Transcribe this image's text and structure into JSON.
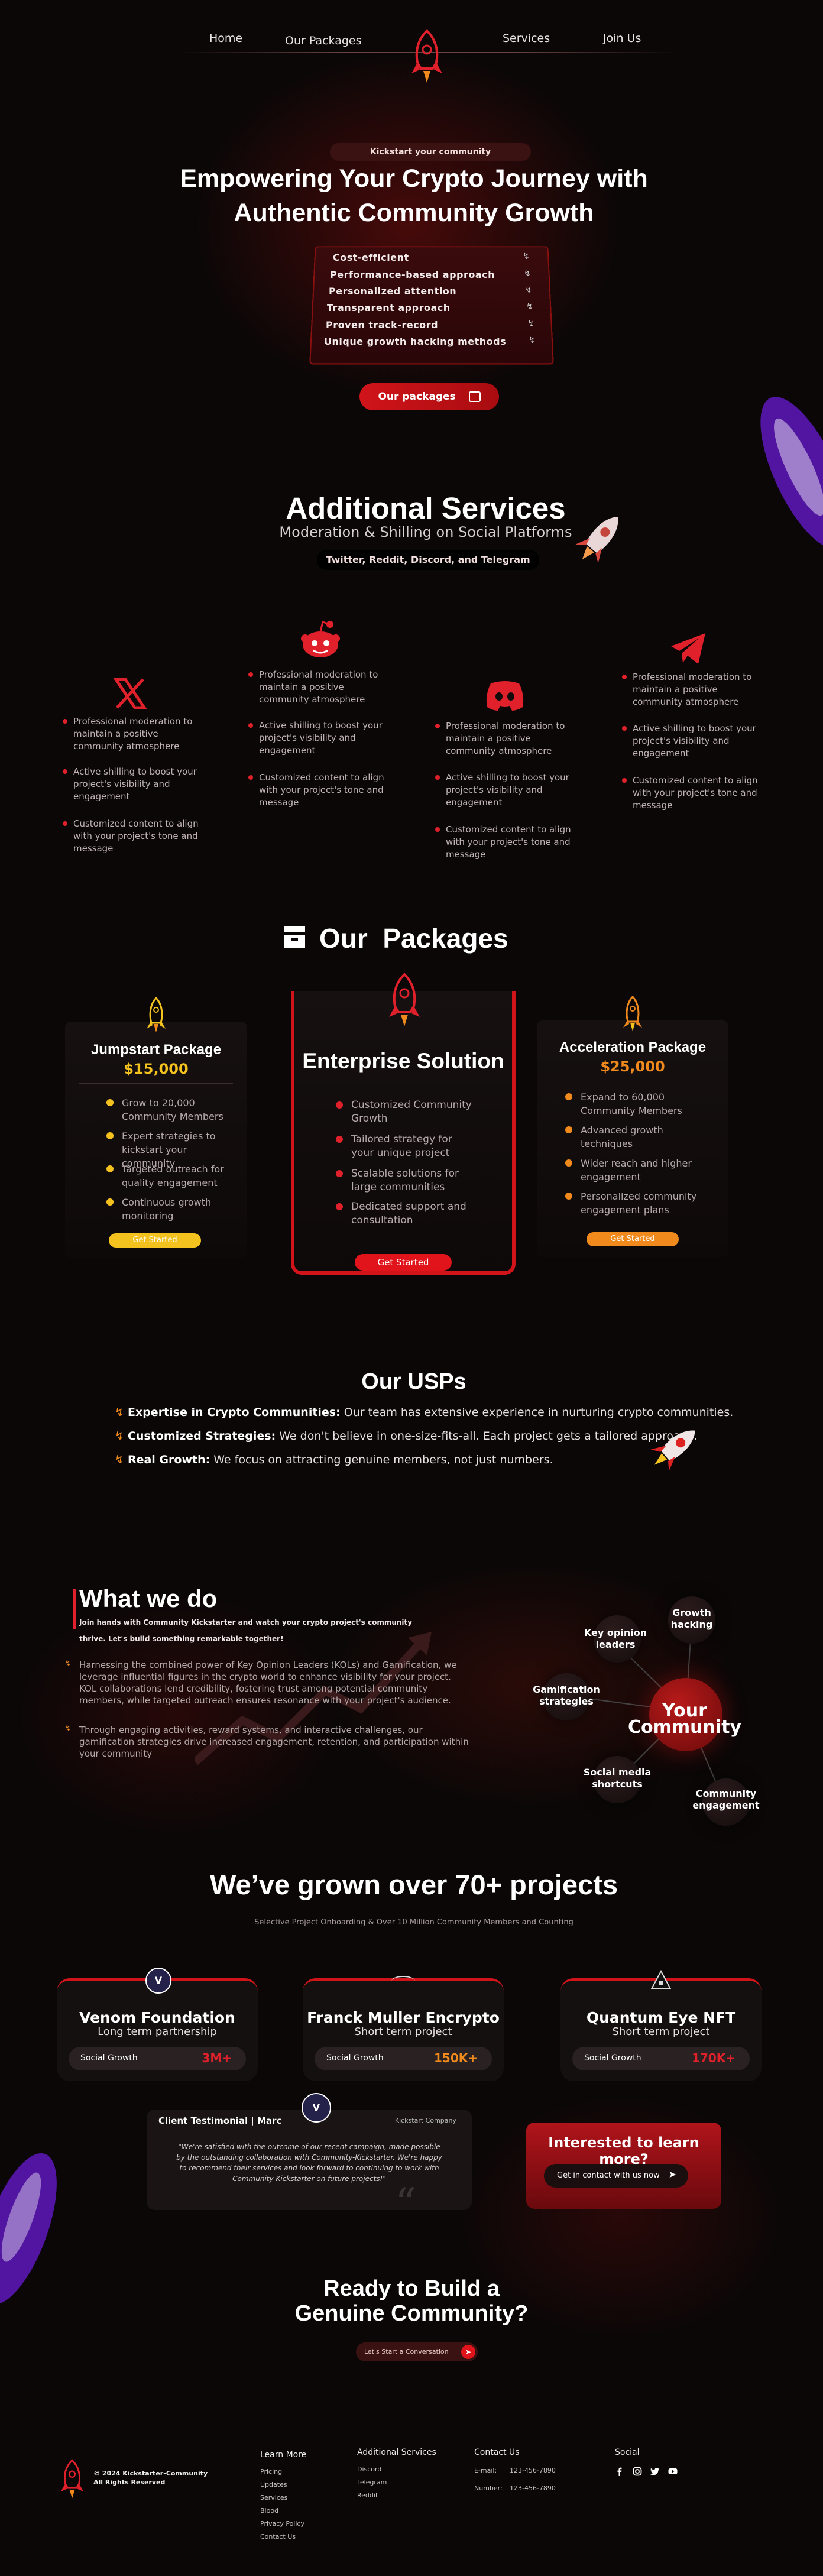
{
  "nav": {
    "home": "Home",
    "packages": "Our Packages",
    "services": "Services",
    "join": "Join Us"
  },
  "hero": {
    "badge": "Kickstart your community",
    "title_line1": "Empowering Your Crypto Journey with",
    "title_line2": "Authentic Community Growth",
    "features": [
      "Cost-efficient",
      "Performance-based approach",
      "Personalized attention",
      "Transparent approach",
      "Proven track-record",
      "Unique growth hacking methods"
    ],
    "cta": "Our packages"
  },
  "services": {
    "title": "Additional Services",
    "subtitle": "Moderation & Shilling on Social Platforms",
    "platforms": "Twitter, Reddit, Discord, and Telegram",
    "columns": [
      {
        "icon": "x-twitter-icon",
        "items": [
          "Professional moderation to maintain a positive community atmosphere",
          "Active shilling to boost your project's visibility and engagement",
          "Customized content to align with your project's tone and message"
        ]
      },
      {
        "icon": "reddit-icon",
        "items": [
          "Professional moderation to maintain a positive community atmosphere",
          "Active shilling to boost your project's visibility and engagement",
          "Customized content to align with your project's tone and message"
        ]
      },
      {
        "icon": "discord-icon",
        "items": [
          "Professional moderation to maintain a positive community atmosphere",
          "Active shilling to boost your project's visibility and engagement",
          "Customized content to align with your project's tone and message"
        ]
      },
      {
        "icon": "telegram-icon",
        "items": [
          "Professional moderation to maintain a positive community atmosphere",
          "Active shilling to boost your project's visibility and engagement",
          "Customized content to align with your project's tone and message"
        ]
      }
    ]
  },
  "packages": {
    "title": "Our  Packages",
    "items": [
      {
        "name": "Jumpstart Package",
        "price": "$15,000",
        "accent": "#f3c21f",
        "features": [
          "Grow to 20,000 Community Members",
          "Expert strategies to kickstart your community",
          "Targeted outreach for quality engagement",
          "Continuous growth monitoring"
        ],
        "cta": "Get Started"
      },
      {
        "name": "Enterprise Solution",
        "price": "",
        "accent": "#e0202a",
        "features": [
          "Customized Community Growth",
          "Tailored strategy for your unique project",
          "Scalable solutions for large communities",
          "Dedicated support and consultation"
        ],
        "cta": "Get Started"
      },
      {
        "name": "Acceleration Package",
        "price": "$25,000",
        "accent": "#f08a1c",
        "features": [
          "Expand to 60,000 Community Members",
          "Advanced growth techniques",
          "Wider reach and higher engagement",
          "Personalized community engagement plans"
        ],
        "cta": "Get Started"
      }
    ]
  },
  "usps": {
    "title": "Our USPs",
    "items": [
      {
        "bold": "Expertise in Crypto Communities:",
        "text": " Our team has extensive experience in nurturing crypto communities."
      },
      {
        "bold": "Customized Strategies:",
        "text": " We don't believe in one-size-fits-all. Each project gets a tailored approach."
      },
      {
        "bold": "Real Growth:",
        "text": " We focus on attracting genuine members, not just numbers."
      }
    ]
  },
  "whatwedo": {
    "title": "What we do",
    "intro_line1": "Join hands with Community Kickstarter and watch your crypto project's community",
    "intro_line2": "thrive. Let's build something remarkable together!",
    "para1": "Harnessing the combined power of Key Opinion Leaders (KOLs) and Gamification, we leverage influential figures in the crypto world to enhance visibility for your project. KOL collaborations lend credibility, fostering trust among potential community members, while targeted outreach ensures resonance with your project's audience.",
    "para2": "Through engaging activities, reward systems, and interactive challenges, our gamification strategies drive increased engagement, retention, and participation within your community",
    "center": "Your Community",
    "nodes": [
      "Key opinion leaders",
      "Growth hacking",
      "Gamification strategies",
      "Social media shortcuts",
      "Community engagement"
    ]
  },
  "projects": {
    "title": "We’ve grown over 70+ projects",
    "subtitle": "Selective Project Onboarding & Over 10 Million Community Members and Counting",
    "items": [
      {
        "name": "Venom Foundation",
        "term": "Long term partnership",
        "label": "Social Growth",
        "value": "3M+"
      },
      {
        "name": "Franck Muller Encrypto",
        "term": "Short term project",
        "label": "Social Growth",
        "value": "150K+"
      },
      {
        "name": "Quantum Eye NFT",
        "term": "Short term project",
        "label": "Social Growth",
        "value": "170K+"
      }
    ]
  },
  "testimonial": {
    "title": "Client Testimonial | Marc",
    "company": "Kickstart Company",
    "quote": "\"We're satisfied with the outcome of our recent campaign, made possible by the outstanding collaboration with Community-Kickstarter. We're happy to recommend their services and look forward to continuing to work with Community-Kickstarter on future projects!\""
  },
  "interest": {
    "title": "Interested to learn more?",
    "cta": "Get in contact with us now"
  },
  "ready": {
    "line1": "Ready to Build a",
    "line2": "Genuine Community?",
    "cta": "Let's Start a Conversation"
  },
  "footer": {
    "copyright_line1": "© 2024 Kickstarter-Community",
    "copyright_line2": "All Rights Reserved",
    "learn_title": "Learn More",
    "learn_links": [
      "Pricing",
      "Updates",
      "Services",
      "Blood",
      "Privacy Policy",
      "Contact Us"
    ],
    "services_title": "Additional Services",
    "services_links": [
      "Discord",
      "Telegram",
      "Reddit"
    ],
    "contact_title": "Contact Us",
    "email_label": "E-mail:",
    "email_value": "123-456-7890",
    "number_label": "Number:",
    "number_value": "123-456-7890",
    "social_title": "Social",
    "social_icons": [
      "facebook-icon",
      "instagram-icon",
      "twitter-icon",
      "youtube-icon"
    ]
  }
}
